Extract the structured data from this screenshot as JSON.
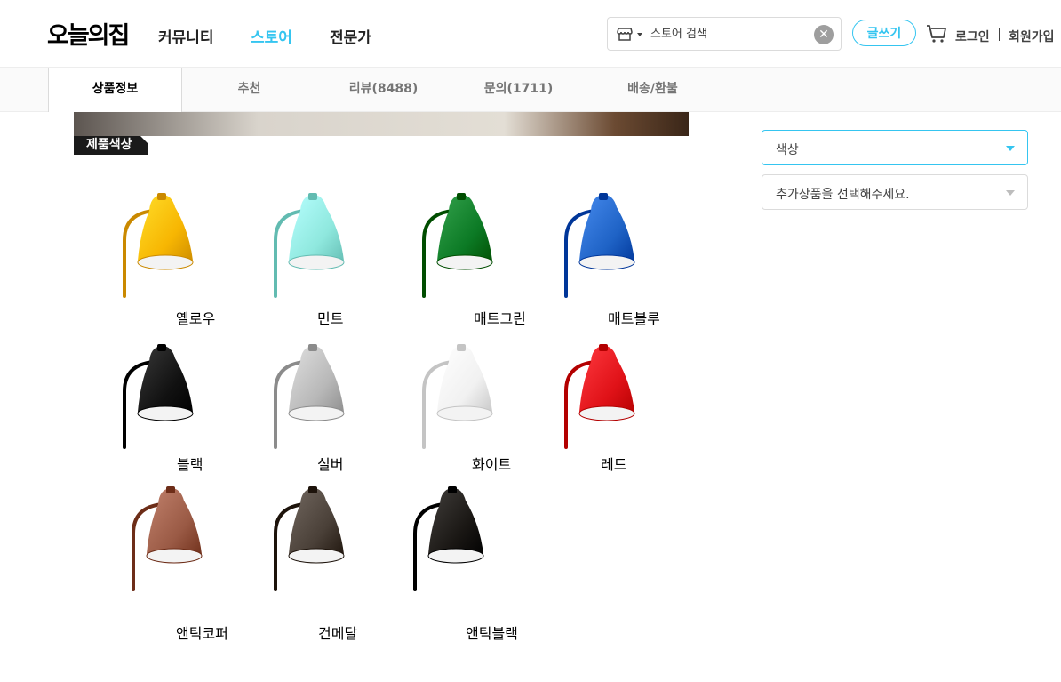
{
  "header": {
    "logo": "오늘의집",
    "nav": [
      "커뮤니티",
      "스토어",
      "전문가"
    ],
    "search_placeholder": "스토어 검색",
    "write_label": "글쓰기",
    "login": "로그인",
    "signup": "회원가입"
  },
  "tabs": [
    "상품정보",
    "추천",
    "리뷰(8488)",
    "문의(1711)",
    "배송/환불"
  ],
  "section_label": "제품색상",
  "colors": [
    {
      "name": "옐로우",
      "color": "#f7b602"
    },
    {
      "name": "민트",
      "color": "#8fe8de"
    },
    {
      "name": "매트그린",
      "color": "#0c7a25"
    },
    {
      "name": "매트블루",
      "color": "#1f63c6"
    },
    {
      "name": "블랙",
      "color": "#111111"
    },
    {
      "name": "실버",
      "color": "#b8b8b8"
    },
    {
      "name": "화이트",
      "color": "#f1f1f1"
    },
    {
      "name": "레드",
      "color": "#e01218"
    },
    {
      "name": "앤틱코퍼",
      "color": "#9a5a45"
    },
    {
      "name": "건메탈",
      "color": "#4a4038"
    },
    {
      "name": "앤틱블랙",
      "color": "#1a1714"
    }
  ],
  "options": {
    "color_select": "색상",
    "extra_select": "추가상품을 선택해주세요."
  },
  "theme": {
    "accent": "#35c5f0"
  }
}
